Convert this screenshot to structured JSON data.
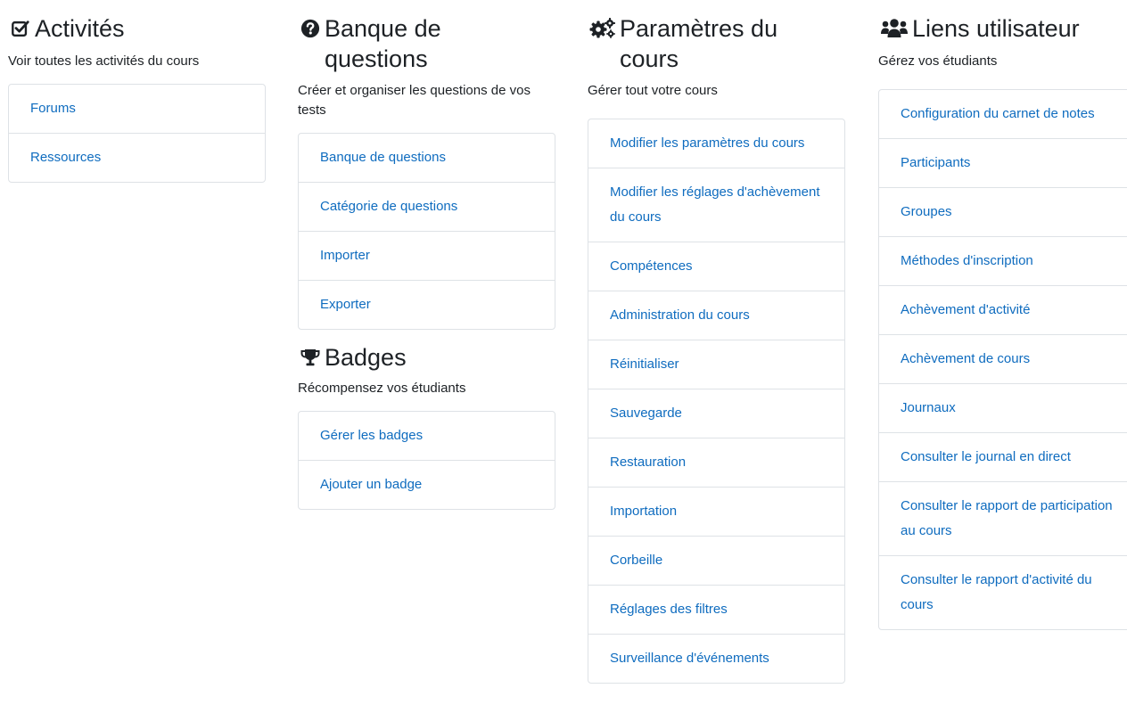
{
  "sections": {
    "activites": {
      "title": "Activités",
      "icon": "check-square-icon",
      "description": "Voir toutes les activités du cours",
      "items": [
        {
          "label": "Forums"
        },
        {
          "label": "Ressources"
        }
      ]
    },
    "banque": {
      "title": "Banque de questions",
      "icon": "question-circle-icon",
      "description": "Créer et organiser les questions de vos tests",
      "items": [
        {
          "label": "Banque de questions"
        },
        {
          "label": "Catégorie de questions"
        },
        {
          "label": "Importer"
        },
        {
          "label": "Exporter"
        }
      ]
    },
    "badges": {
      "title": "Badges",
      "icon": "trophy-icon",
      "description": "Récompensez vos étudiants",
      "items": [
        {
          "label": "Gérer les badges"
        },
        {
          "label": "Ajouter un badge"
        }
      ]
    },
    "parametres": {
      "title": "Paramètres du cours",
      "icon": "cogs-icon",
      "description": "Gérer tout votre cours",
      "items": [
        {
          "label": "Modifier les paramètres du cours"
        },
        {
          "label": "Modifier les réglages d'achèvement du cours"
        },
        {
          "label": "Compétences"
        },
        {
          "label": "Administration du cours"
        },
        {
          "label": "Réinitialiser"
        },
        {
          "label": "Sauvegarde"
        },
        {
          "label": "Restauration"
        },
        {
          "label": "Importation"
        },
        {
          "label": "Corbeille"
        },
        {
          "label": "Réglages des filtres"
        },
        {
          "label": "Surveillance d'événements"
        }
      ]
    },
    "liens": {
      "title": "Liens utilisateur",
      "icon": "users-icon",
      "description": "Gérez vos étudiants",
      "items": [
        {
          "label": "Configuration du carnet de notes"
        },
        {
          "label": "Participants"
        },
        {
          "label": "Groupes"
        },
        {
          "label": "Méthodes d'inscription"
        },
        {
          "label": "Achèvement d'activité"
        },
        {
          "label": "Achèvement de cours"
        },
        {
          "label": "Journaux"
        },
        {
          "label": "Consulter le journal en direct"
        },
        {
          "label": "Consulter le rapport de participation au cours"
        },
        {
          "label": "Consulter le rapport d'activité du cours"
        }
      ]
    }
  },
  "colors": {
    "link": "#0f6cbf",
    "text": "#1d2125",
    "border": "#dee2e6"
  }
}
